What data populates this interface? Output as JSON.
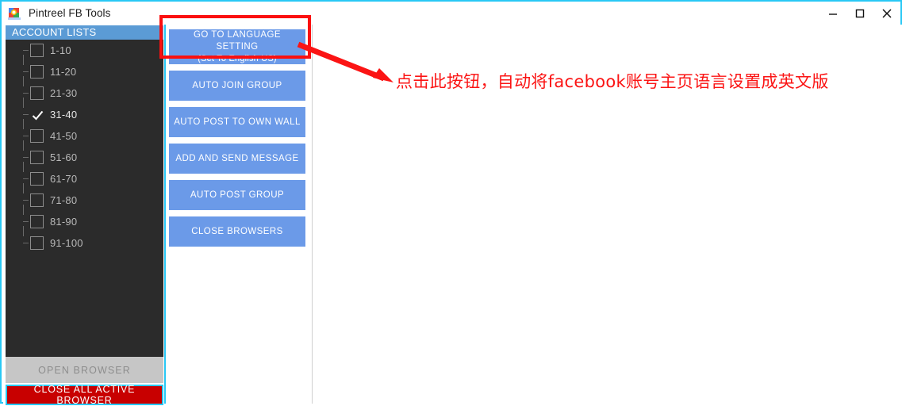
{
  "window": {
    "title": "Pintreel FB Tools",
    "icon": "app-logo-icon",
    "controls": {
      "minimize": "minimize-icon",
      "maximize": "maximize-icon",
      "close": "close-icon"
    },
    "border_color": "#29c8f5"
  },
  "sidebar": {
    "header": "ACCOUNT LISTS",
    "header_color": "#5b9bd5",
    "background": "#2b2b2b",
    "items": [
      {
        "label": "1-10",
        "checked": false
      },
      {
        "label": "11-20",
        "checked": false
      },
      {
        "label": "21-30",
        "checked": false
      },
      {
        "label": "31-40",
        "checked": true
      },
      {
        "label": "41-50",
        "checked": false
      },
      {
        "label": "51-60",
        "checked": false
      },
      {
        "label": "61-70",
        "checked": false
      },
      {
        "label": "71-80",
        "checked": false
      },
      {
        "label": "81-90",
        "checked": false
      },
      {
        "label": "91-100",
        "checked": false
      }
    ],
    "open_browser": {
      "label": "OPEN BROWSER",
      "disabled": true,
      "background": "#c6c6c6",
      "text_color": "#8d8d8d"
    },
    "close_all": {
      "label": "CLOSE ALL ACTIVE BROWSER",
      "background": "#c80000",
      "text_color": "#ffffff"
    }
  },
  "actions": {
    "button_color": "#6b9ae8",
    "buttons": [
      {
        "label": "GO TO LANGUAGE SETTING",
        "sublabel": "(Set To English US)",
        "highlighted": true
      },
      {
        "label": "AUTO JOIN GROUP",
        "sublabel": ""
      },
      {
        "label": "AUTO POST TO OWN WALL",
        "sublabel": ""
      },
      {
        "label": "ADD AND SEND MESSAGE",
        "sublabel": ""
      },
      {
        "label": "AUTO POST GROUP",
        "sublabel": ""
      },
      {
        "label": "CLOSE BROWSERS",
        "sublabel": ""
      }
    ]
  },
  "annotation": {
    "text": "点击此按钮，自动将facebook账号主页语言设置成英文版",
    "color": "#fb1414",
    "box_color": "#fb0f0f"
  }
}
